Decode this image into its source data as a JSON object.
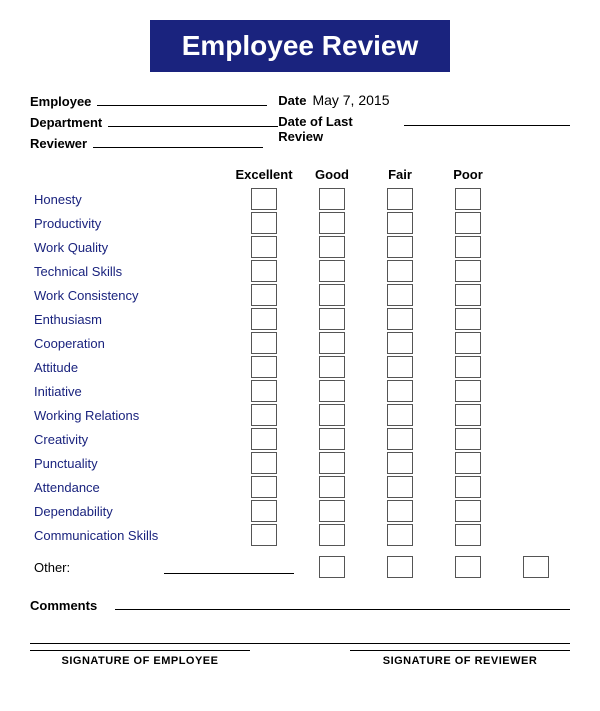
{
  "title": "Employee Review",
  "header": {
    "employee_label": "Employee",
    "department_label": "Department",
    "reviewer_label": "Reviewer",
    "date_label": "Date",
    "date_value": "May 7, 2015",
    "date_of_last_review_label": "Date of Last Review"
  },
  "columns": [
    "Excellent",
    "Good",
    "Fair",
    "Poor"
  ],
  "criteria": [
    "Honesty",
    "Productivity",
    "Work Quality",
    "Technical Skills",
    "Work Consistency",
    "Enthusiasm",
    "Cooperation",
    "Attitude",
    "Initiative",
    "Working Relations",
    "Creativity",
    "Punctuality",
    "Attendance",
    "Dependability",
    "Communication Skills"
  ],
  "other_label": "Other:",
  "comments_label": "Comments",
  "sig_employee": "SIGNATURE OF EMPLOYEE",
  "sig_reviewer": "SIGNATURE OF REVIEWER"
}
